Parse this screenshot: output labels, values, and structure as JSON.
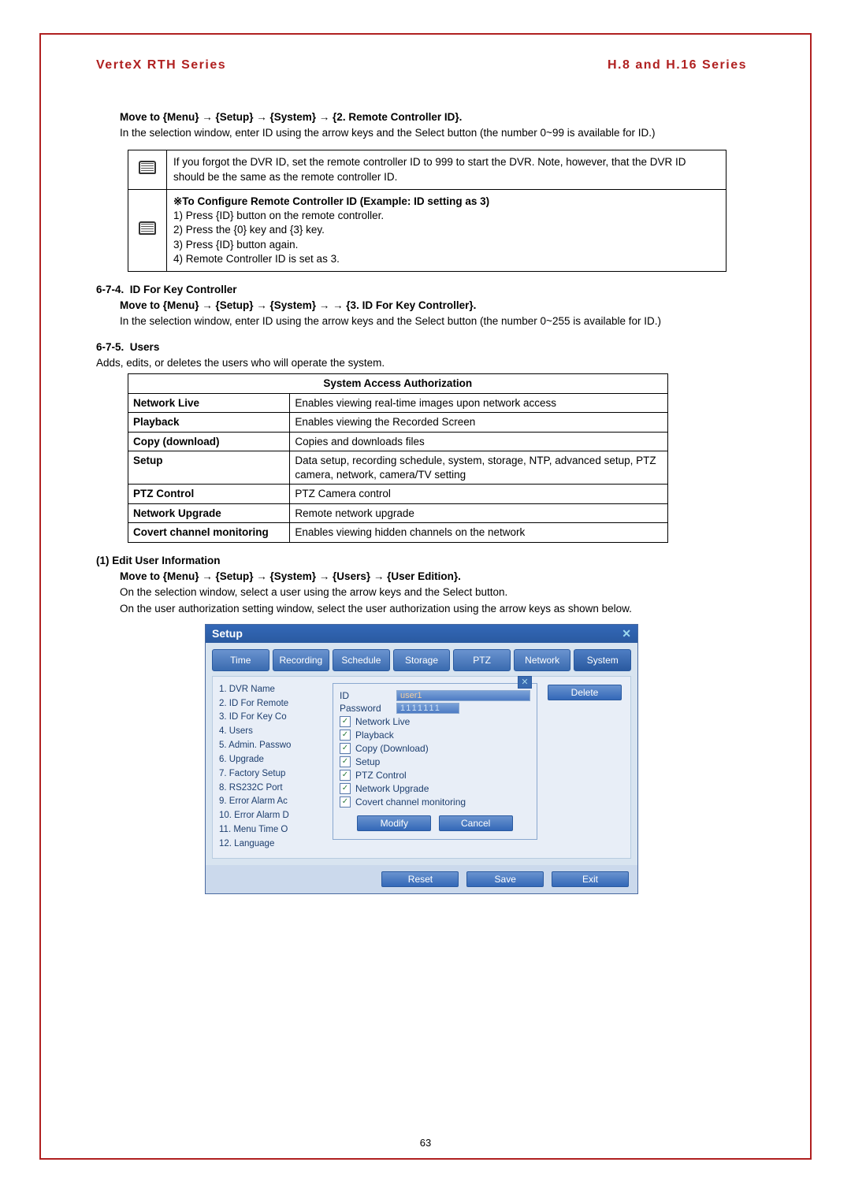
{
  "header": {
    "left": "VerteX RTH Series",
    "right": "H.8 and H.16 Series"
  },
  "intro": {
    "move_to": "Move to {Menu} → {Setup} → {System} → {2. Remote Controller ID}.",
    "desc": "In the selection window, enter ID using the arrow keys and the Select button (the number 0~99 is available for ID.)"
  },
  "notes": {
    "row1": "If you forgot the DVR ID, set the remote controller ID to 999 to start the DVR. Note, however, that the DVR ID should be the same as the remote controller ID.",
    "row2_title": "※To Configure Remote Controller ID (Example: ID setting as 3)",
    "row2_l1": "1) Press {ID} button on the remote controller.",
    "row2_l2": "2) Press the {0} key and {3} key.",
    "row2_l3": "3) Press {ID} button again.",
    "row2_l4": "4) Remote Controller ID is set as 3."
  },
  "sec674": {
    "num": "6-7-4.",
    "title": "ID For Key Controller",
    "move_to": "Move to {Menu} → {Setup} → {System} → → {3. ID For Key Controller}.",
    "desc": "In the selection window, enter ID using the arrow keys and the Select button (the number 0~255 is available for ID.)"
  },
  "sec675": {
    "num": "6-7-5.",
    "title": "Users",
    "desc": "Adds, edits, or deletes the users who will operate the system."
  },
  "auth": {
    "caption": "System Access Authorization",
    "rows": [
      {
        "k": "Network Live",
        "v": "Enables viewing real-time images upon network access"
      },
      {
        "k": "Playback",
        "v": "Enables viewing the Recorded Screen"
      },
      {
        "k": "Copy (download)",
        "v": "Copies and downloads files"
      },
      {
        "k": "Setup",
        "v": "Data setup, recording schedule, system, storage, NTP, advanced setup, PTZ camera, network, camera/TV setting"
      },
      {
        "k": "PTZ Control",
        "v": "PTZ Camera control"
      },
      {
        "k": "Network Upgrade",
        "v": "Remote network upgrade"
      },
      {
        "k": "Covert channel monitoring",
        "v": "Enables viewing hidden channels on the network"
      }
    ]
  },
  "edit_user": {
    "heading": "(1) Edit User Information",
    "move_to": "Move to {Menu} → {Setup} → {System} → {Users} → {User Edition}.",
    "l1": "On the selection window, select a user using the arrow keys and the Select button.",
    "l2": "On the user authorization setting window, select the user authorization using the arrow keys as shown below."
  },
  "setup": {
    "title": "Setup",
    "tabs": [
      "Time",
      "Recording",
      "Schedule",
      "Storage",
      "PTZ",
      "Network",
      "System"
    ],
    "active_tab": 6,
    "menu": [
      "1. DVR Name",
      "2. ID For Remote",
      "3. ID For Key Co",
      "4. Users",
      "5. Admin. Passwo",
      "6. Upgrade",
      "7. Factory Setup",
      "8. RS232C Port",
      "9. Error Alarm Ac",
      "10. Error Alarm D",
      "11. Menu Time O",
      "12. Language"
    ],
    "id_label": "ID",
    "id_value": "user1",
    "pw_label": "Password",
    "pw_value": "1111111",
    "perms": [
      "Network Live",
      "Playback",
      "Copy (Download)",
      "Setup",
      "PTZ Control",
      "Network Upgrade",
      "Covert channel monitoring"
    ],
    "buttons": {
      "modify": "Modify",
      "cancel": "Cancel",
      "delete": "Delete",
      "reset": "Reset",
      "save": "Save",
      "exit": "Exit"
    }
  },
  "page_number": "63"
}
